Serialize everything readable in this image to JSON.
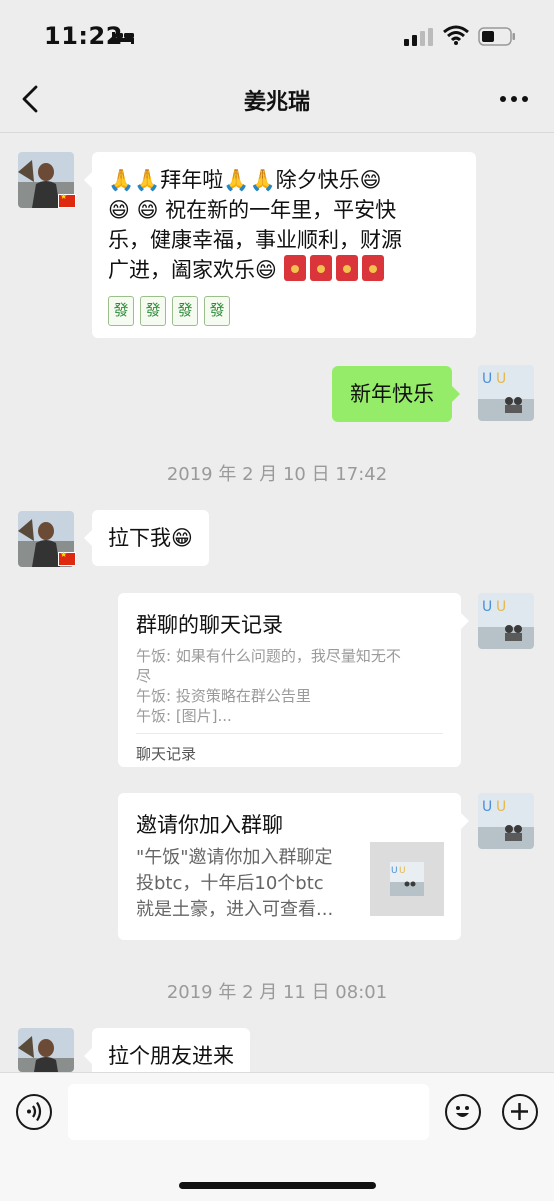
{
  "status_bar": {
    "time": "11:22"
  },
  "nav": {
    "title": "姜兆瑞"
  },
  "messages": [
    {
      "side": "left",
      "text": "🙏🙏拜年啦🙏🙏除夕快乐😄😄 😄 祝在新的一年里，平安快乐，健康幸福，事业顺利，财源广进，阖家欢乐😄",
      "stickers": "🧧🧧🧧🧧 🀅🀅🀅🀅"
    },
    {
      "side": "right",
      "text": "新年快乐"
    },
    {
      "side": "time",
      "text": "2019 年 2 月 10 日 17:42"
    },
    {
      "side": "left",
      "text": "拉下我😁"
    },
    {
      "side": "right",
      "card": {
        "title": "群聊的聊天记录",
        "lines": [
          "午饭: 如果有什么问题的，我尽量知无不尽",
          "午饭: 投资策略在群公告里",
          "午饭: [图片]..."
        ],
        "footer": "聊天记录"
      }
    },
    {
      "side": "right",
      "card": {
        "title": "邀请你加入群聊",
        "desc": "\"午饭\"邀请你加入群聊定投btc，十年后10个btc就是土豪，进入可查看..."
      }
    },
    {
      "side": "time",
      "text": "2019 年 2 月 11 日 08:01"
    },
    {
      "side": "left",
      "text": "拉个朋友进来"
    }
  ],
  "msg1": {
    "line1": "🙏🙏拜年啦🙏🙏除夕快乐😄",
    "line2": "😄 😄 祝在新的一年里，平安快",
    "line3": "乐，健康幸福，事业顺利，财源",
    "line4": "广进，阖家欢乐😄"
  },
  "msg2": "新年快乐",
  "ts1": "2019 年 2 月 10 日 17:42",
  "msg3": "拉下我😁",
  "card1": {
    "title": "群聊的聊天记录",
    "line1": "午饭: 如果有什么问题的，我尽量知无不",
    "line1b": "尽",
    "line2": "午饭: 投资策略在群公告里",
    "line3": "午饭: [图片]...",
    "footer": "聊天记录"
  },
  "card2": {
    "title": "邀请你加入群聊",
    "desc1": "\"午饭\"邀请你加入群聊定",
    "desc2": "投btc，十年后10个btc",
    "desc3": "就是土豪，进入可查看..."
  },
  "ts2": "2019 年 2 月 11 日 08:01",
  "msg4": "拉个朋友进来",
  "icons": {
    "mahjong_glyph": "發"
  },
  "colors": {
    "background": "#ededed",
    "bubble_self": "#95ec69",
    "bubble_other": "#ffffff",
    "timestamp": "#9a9a9a",
    "red_envelope": "#d9353a"
  }
}
